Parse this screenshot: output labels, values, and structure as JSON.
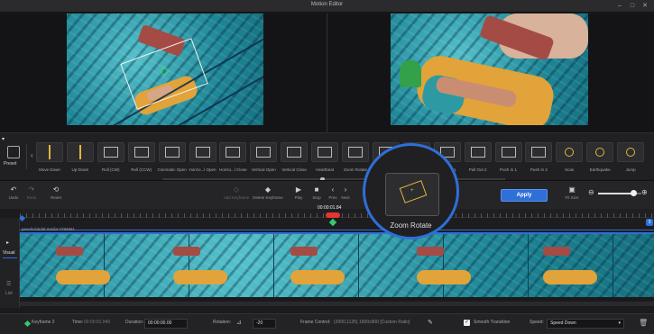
{
  "window": {
    "title": "Motion Editor"
  },
  "preview": {},
  "presets": {
    "preset_label": "Preset",
    "items": [
      {
        "label": "Move Down"
      },
      {
        "label": "Up-Down"
      },
      {
        "label": "Roll (CW)"
      },
      {
        "label": "Roll (CCW)"
      },
      {
        "label": "Cinematic Open"
      },
      {
        "label": "Horizo...l Open"
      },
      {
        "label": "Horizo...l Close"
      },
      {
        "label": "Vertical Open"
      },
      {
        "label": "Vertical Close"
      },
      {
        "label": "Heartbeat"
      },
      {
        "label": "Zoom Rotate"
      },
      {
        "label": ""
      },
      {
        "label": ""
      },
      {
        "label": "Pull Out 1"
      },
      {
        "label": "Pull Out 2"
      },
      {
        "label": "Push In 1"
      },
      {
        "label": "Push In 2"
      },
      {
        "label": "Scan"
      },
      {
        "label": "Earthquake"
      },
      {
        "label": "Jump"
      }
    ]
  },
  "toolbar": {
    "undo": "Undo",
    "redo": "Redo",
    "reset": "Reset",
    "add_keyframe": "Add Keyframe",
    "delete_keyframe": "Delete Keyframe",
    "play": "Play",
    "stop": "Stop",
    "prev": "Prev",
    "next": "Next",
    "apply": "Apply",
    "fit_size": "Fit Size"
  },
  "timeline": {
    "current_time": "00:00:01.84",
    "clip_name": "pexels-kindel-media-7294661",
    "tabs": {
      "visual": "Visual",
      "list": "List"
    },
    "track_number": "3"
  },
  "magnifier": {
    "label": "Zoom Rotate"
  },
  "bottom": {
    "keyframe_label": "Keyframe 2",
    "time_label": "Time:",
    "time_value": "00:00:01.840",
    "duration_label": "Duration:",
    "duration_value": "00:00:00.00",
    "rotation_label": "Rotation:",
    "rotation_value": "-20",
    "frame_control_label": "Frame Control:",
    "frame_control_value": "(2000,1125) 1600x900 [Custom Ratio]",
    "smooth_label": "Smooth Transition",
    "smooth_checked": true,
    "speed_label": "Speed:",
    "speed_value": "Speed Down"
  },
  "colors": {
    "accent": "#2e6fd8",
    "keyframe": "#e5372d",
    "keyframe_marker": "#37c86a",
    "preset_yellow": "#e3b43a"
  }
}
